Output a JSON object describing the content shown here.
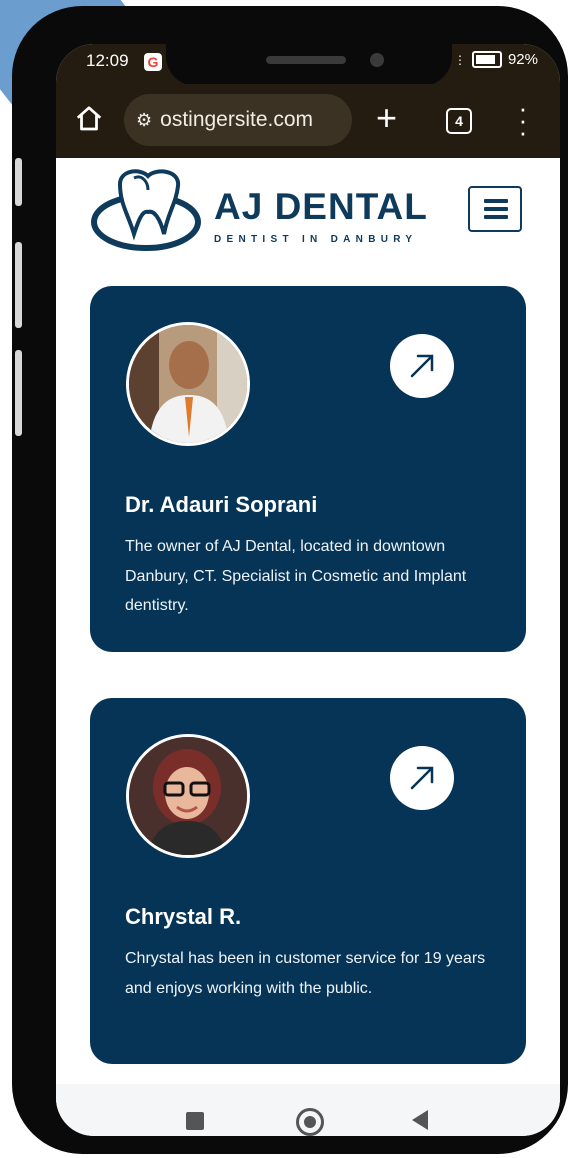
{
  "status_bar": {
    "time": "12:09",
    "app_badge": "G",
    "battery": "92%"
  },
  "browser": {
    "url": "ostingersite.com",
    "tab_count": "4"
  },
  "site": {
    "logo_title": "AJ DENTAL",
    "logo_subtitle": "DENTIST IN DANBURY"
  },
  "team": [
    {
      "name": "Dr. Adauri Soprani",
      "description": "The owner of AJ Dental, located in downtown Danbury, CT. Specialist in Cosmetic and Implant dentistry."
    },
    {
      "name": "Chrystal R.",
      "description": "Chrystal has been in customer service for 19 years and enjoys working with the public."
    }
  ],
  "colors": {
    "brand_navy": "#063456",
    "logo_navy": "#0e3a5c",
    "browser_chrome": "#241c10"
  },
  "icons": {
    "home": "home-icon",
    "site_settings": "tune-icon",
    "new_tab": "plus-icon",
    "tabs": "tabs-icon",
    "menu": "more-vert-icon",
    "card_link": "arrow-up-right-icon"
  }
}
